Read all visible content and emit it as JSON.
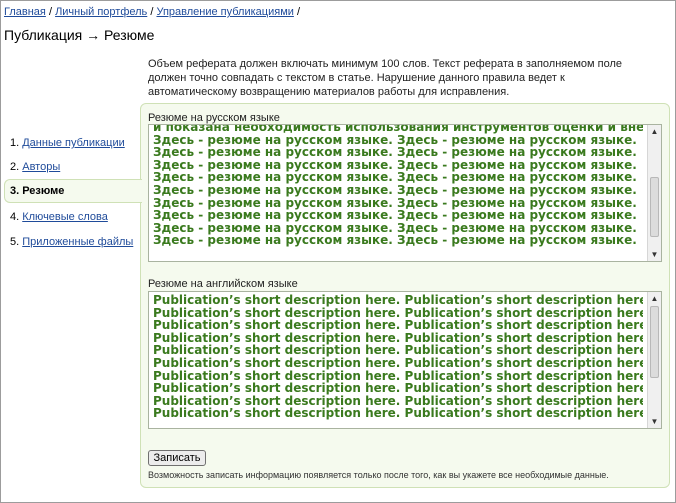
{
  "breadcrumb": {
    "home": "Главная",
    "portfolio": "Личный портфель",
    "manage": "Управление публикациями",
    "sep": "/"
  },
  "page_title": "Публикация → Резюме",
  "notice": "Объем реферата должен включать минимум 100 слов. Текст реферата в заполняемом поле должен точно совпадать с текстом в статье. Нарушение данного правила ведет к автоматическому возвращению материалов работы для исправления.",
  "nav": {
    "items": [
      {
        "label": "1. ",
        "link": "Данные публикации"
      },
      {
        "label": "2. ",
        "link": "Авторы"
      },
      {
        "label": "3. Резюме"
      },
      {
        "label": "4. ",
        "link": "Ключевые слова"
      },
      {
        "label": "5. ",
        "link": "Приложенные файлы"
      }
    ]
  },
  "russian": {
    "label": "Резюме на русском языке",
    "cut_line": "и показана необходимость использования инструментов оценки и внешних",
    "line": "Здесь - резюме на русском языке. Здесь - резюме на русском языке."
  },
  "english": {
    "label": "Резюме на английском языке",
    "line": "Publication’s short description here. Publication’s short description here."
  },
  "save_label": "Записать",
  "hint": "Возможность записать информацию появляется только после того, как вы укажете все необходимые данные."
}
